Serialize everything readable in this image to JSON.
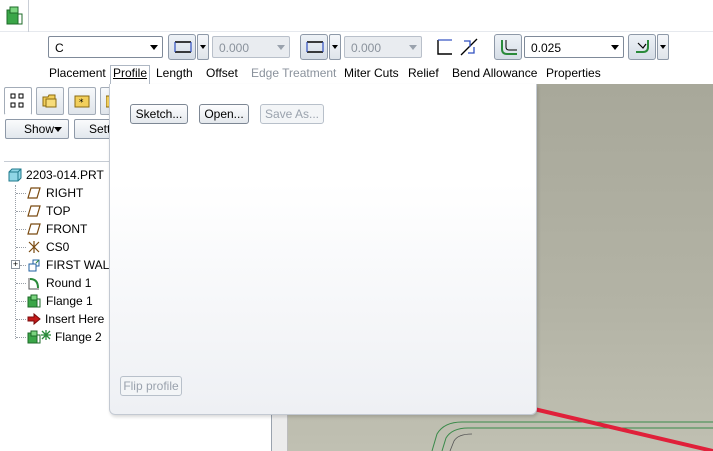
{
  "toolbar": {
    "shape_combo_value": "C",
    "length_value_1": "0.000",
    "length_value_2": "0.000",
    "radius_value": "0.025"
  },
  "tabs": [
    {
      "label": "Placement",
      "state": "normal"
    },
    {
      "label": "Profile",
      "state": "active"
    },
    {
      "label": "Length",
      "state": "normal"
    },
    {
      "label": "Offset",
      "state": "normal"
    },
    {
      "label": "Edge Treatment",
      "state": "disabled"
    },
    {
      "label": "Miter Cuts",
      "state": "normal"
    },
    {
      "label": "Relief",
      "state": "normal"
    },
    {
      "label": "Bend Allowance",
      "state": "normal"
    },
    {
      "label": "Properties",
      "state": "normal"
    }
  ],
  "left_panel": {
    "show_button": "Show",
    "settings_button": "Setti"
  },
  "tree": {
    "items": [
      {
        "label": "2203-014.PRT",
        "icon": "part-icon"
      },
      {
        "label": "RIGHT",
        "icon": "datum-plane-icon"
      },
      {
        "label": "TOP",
        "icon": "datum-plane-icon"
      },
      {
        "label": "FRONT",
        "icon": "datum-plane-icon"
      },
      {
        "label": "CS0",
        "icon": "coordinate-system-icon"
      },
      {
        "label": "FIRST WALL",
        "icon": "wall-feature-icon"
      },
      {
        "label": "Round 1",
        "icon": "round-icon"
      },
      {
        "label": "Flange 1",
        "icon": "flange-icon"
      },
      {
        "label": "Insert Here",
        "icon": "insert-arrow-icon"
      },
      {
        "label": "Flange 2",
        "icon": "flange-icon"
      }
    ]
  },
  "profile_panel": {
    "sketch_button": "Sketch...",
    "open_button": "Open...",
    "save_as_button": "Save As...",
    "flip_profile_button": "Flip profile"
  },
  "colors": {
    "accent_border": "#7d8794",
    "graphics_bg": "#b3b3a5",
    "edge_highlight": "#e0203a"
  }
}
